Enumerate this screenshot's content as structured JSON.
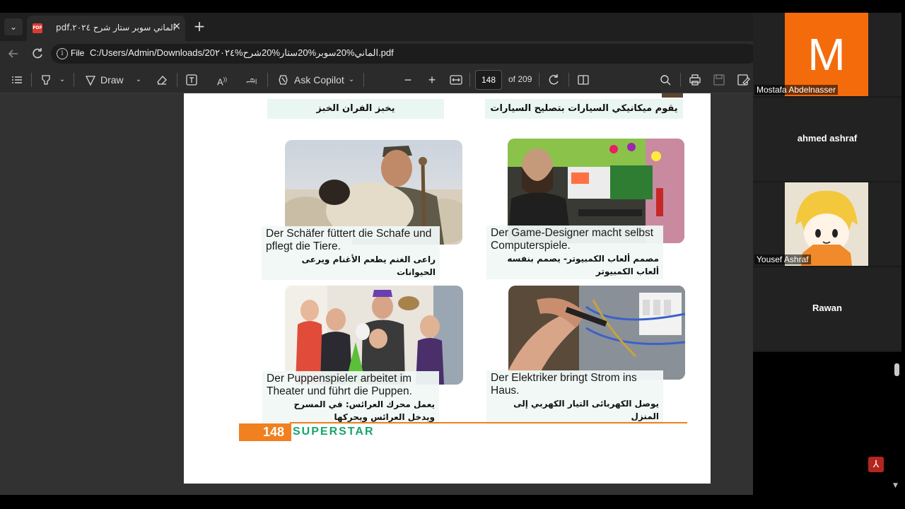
{
  "tab": {
    "title": "الماني سوبر ستار شرح ٢٠٢٤.pdf",
    "close": "✕",
    "new_tab": "+",
    "menu": "⌄"
  },
  "address": {
    "scheme": "File",
    "url": "C:/Users/Admin/Downloads/20الماني%20سوبر%20ستار%20شرح%٢٠٢٤.pdf"
  },
  "toolbar": {
    "draw_label": "Draw",
    "copilot_label": "Ask Copilot",
    "page_number": "148",
    "page_total": "of 209"
  },
  "pdf": {
    "top_left_arabic": "يخبز الفران الخبز",
    "top_right_arabic": "يقوم ميكانيكي السيارات بتصليح السيارات",
    "cards": [
      {
        "de_line1": "Der Schäfer füttert die Schafe und",
        "de_line2": "pflegt die Tiere.",
        "ar": "راعى الغنم يطعم الأغنام ويرعى الحيوانات"
      },
      {
        "de_line1": "Der Game-Designer macht selbst",
        "de_line2": "Computerspiele.",
        "ar": "مصمم ألعاب الكمبيوتر- يصمم بنفسه ألعاب الكمبيوتر"
      },
      {
        "de_line1": "Der Puppenspieler arbeitet im",
        "de_line2": "Theater und führt die Puppen.",
        "ar": "يعمل محرك العرائس: في المسرح ويدخل العرائس ويحركها"
      },
      {
        "de_line1": "Der Elektriker bringt Strom ins Haus.",
        "de_line2": "",
        "ar": "يوصل الكهربائى التيار الكهربي إلى المنزل"
      }
    ],
    "footer_page": "148",
    "footer_brand": "SUPERSTAR"
  },
  "participants": [
    {
      "name": "Mostafa Abdelnasser",
      "initial": "M",
      "color": "#f46b0c"
    },
    {
      "name": "ahmed ashraf"
    },
    {
      "name": "Yousef Ashraf"
    },
    {
      "name": "Rawan"
    }
  ],
  "icons": [
    "pdf-icon",
    "back-icon",
    "refresh-icon",
    "info-icon",
    "contents-icon",
    "highlight-icon",
    "draw-icon",
    "eraser-icon",
    "text-box-icon",
    "read-aloud-icon",
    "translate-icon",
    "copilot-icon",
    "zoom-out-icon",
    "zoom-in-icon",
    "fit-icon",
    "rotate-icon",
    "page-view-icon",
    "search-icon",
    "print-icon",
    "save-icon",
    "save-as-icon",
    "acrobat-icon"
  ]
}
